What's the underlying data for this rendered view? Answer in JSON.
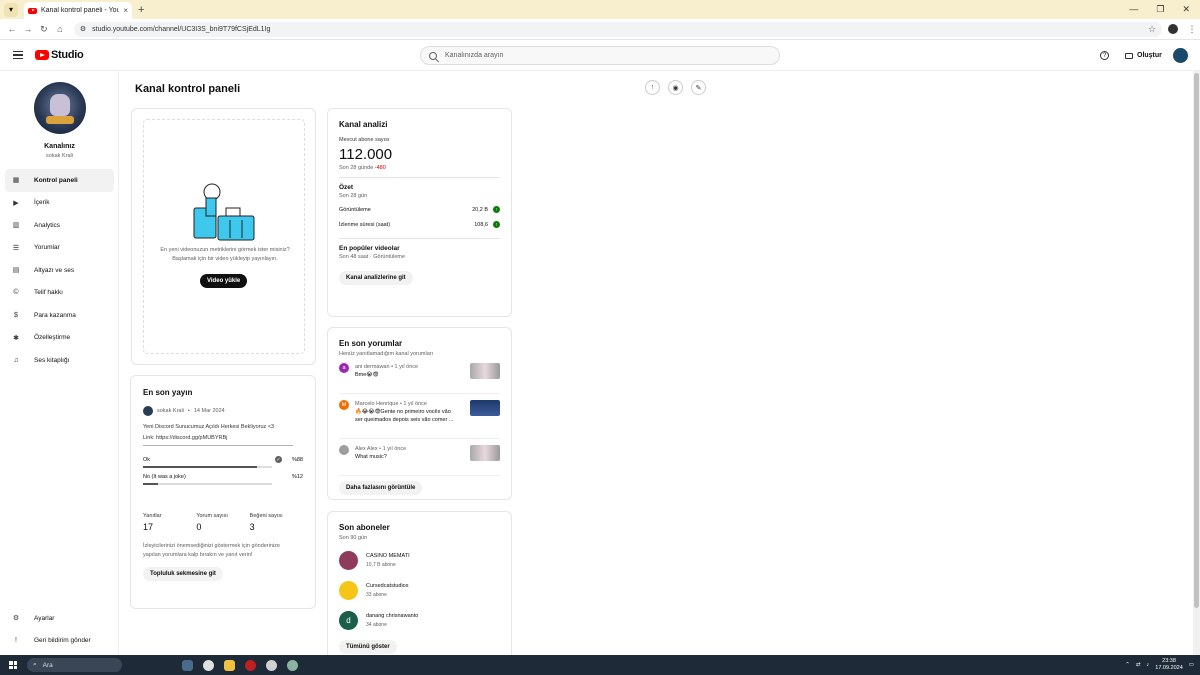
{
  "browser": {
    "tab_title": "Kanal kontrol paneli - YouTube",
    "tab_close": "×",
    "new_tab": "+",
    "url": "studio.youtube.com/channel/UC3I3S_bni9T79fCSjEdL1Ig"
  },
  "header": {
    "logo_text": "Studio",
    "search_placeholder": "Kanalınızda arayın",
    "create_label": "Oluştur"
  },
  "sidebar": {
    "channel_title": "Kanalınız",
    "channel_name": "sokak Krali",
    "items": [
      {
        "label": "Kontrol paneli",
        "icon": "dashboard-icon"
      },
      {
        "label": "İçerik",
        "icon": "content-icon"
      },
      {
        "label": "Analytics",
        "icon": "analytics-icon"
      },
      {
        "label": "Yorumlar",
        "icon": "comments-icon"
      },
      {
        "label": "Altyazı ve ses",
        "icon": "subtitles-icon"
      },
      {
        "label": "Telif hakkı",
        "icon": "copyright-icon"
      },
      {
        "label": "Para kazanma",
        "icon": "money-icon"
      },
      {
        "label": "Özelleştirme",
        "icon": "customization-icon"
      },
      {
        "label": "Ses kitaplığı",
        "icon": "audio-library-icon"
      }
    ],
    "bottom": [
      {
        "label": "Ayarlar",
        "icon": "settings-icon"
      },
      {
        "label": "Geri bildirim gönder",
        "icon": "feedback-icon"
      }
    ]
  },
  "main": {
    "page_title": "Kanal kontrol paneli"
  },
  "upload_card": {
    "text_line1": "En yeni videonuzun metriklerini görmek ister misiniz?",
    "text_line2": "Başlamak için bir video yükleyip yayınlayın.",
    "button": "Video yükle"
  },
  "latest_post": {
    "title": "En son yayın",
    "author": "sokak Krali",
    "date": "14 Mar 2024",
    "text_line1": "Yeni Discord Sunucumuz Açıldı Herkesi Bekliyoruz <3",
    "text_line2": "Link: https://discord.gg/pMUBYRBj",
    "text_line3": "————————————————————————————...",
    "poll": [
      {
        "label": "Ok",
        "percent": "%88",
        "fill": 0.88
      },
      {
        "label": "No (It was a joke)",
        "percent": "%12",
        "fill": 0.12
      }
    ],
    "stats": [
      {
        "label": "Yanıtlar",
        "value": "17"
      },
      {
        "label": "Yorum sayısı",
        "value": "0"
      },
      {
        "label": "Beğeni sayısı",
        "value": "3"
      }
    ],
    "note_line1": "İzleyicilerinizi önemsediğinizi göstermek için gönderinize",
    "note_line2": "yapılan yorumlara kalp bırakın ve yanıt verin!",
    "button": "Topluluk sekmesine git"
  },
  "analytics": {
    "title": "Kanal analizi",
    "subs_label": "Mevcut abone sayısı",
    "subs_value": "112.000",
    "subs_change_label": "Son 28 günde",
    "subs_change": "-480",
    "summary_title": "Özet",
    "summary_sub": "Son 28 gün",
    "rows": [
      {
        "label": "Görüntüleme",
        "value": "20,2 B"
      },
      {
        "label": "İzlenme süresi (saat)",
        "value": "108,6"
      }
    ],
    "popular_title": "En popüler videolar",
    "popular_sub": "Son 48 saat · Görüntüleme",
    "button": "Kanal analizlerine git"
  },
  "comments": {
    "title": "En son yorumlar",
    "sub": "Henüz yanıtlamadığım kanal yorumları",
    "items": [
      {
        "author": "ani dermawan",
        "time": "1 yıl önce",
        "text1": "Bme😭😨",
        "text2": "",
        "avatar": "a",
        "color": "#9c27b0"
      },
      {
        "author": "Marcelo Henrique",
        "time": "1 yıl önce",
        "text1": "🔥😂😭😨Gente no primeiro vocês vão",
        "text2": "ser queimados depois seis vão comer ...",
        "avatar": "M",
        "color": "#ef6c00"
      },
      {
        "author": "Alex Alex",
        "time": "1 yıl önce",
        "text1": "What music?",
        "text2": "",
        "avatar": "",
        "color": "#9e9e9e"
      }
    ],
    "button": "Daha fazlasını görüntüle"
  },
  "subscribers": {
    "title": "Son aboneler",
    "sub": "Son 90 gün",
    "items": [
      {
        "name": "CASINO MEMATI",
        "count": "10,7 B abone",
        "avatar": "",
        "color": "#8e3b5c"
      },
      {
        "name": "Cursedcatstudios",
        "count": "33 abone",
        "avatar": "",
        "color": "#f5c518"
      },
      {
        "name": "danang chrisnawanto",
        "count": "34 abone",
        "avatar": "d",
        "color": "#1b5e4a"
      }
    ],
    "button": "Tümünü göster"
  },
  "taskbar": {
    "search_label": "Ara",
    "time": "23:38",
    "date": "17.09.2024"
  }
}
